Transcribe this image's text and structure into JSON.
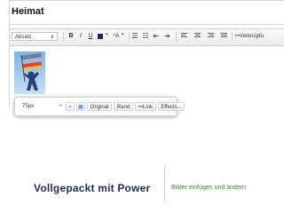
{
  "document": {
    "title": "Heimat"
  },
  "toolbar": {
    "format_select": "Absatz",
    "bold": "B",
    "italic": "I",
    "underline": "U",
    "text_color": "#1a2a55",
    "link_label": "Verknüpfu"
  },
  "image_popup": {
    "size": "75px",
    "original": "Original",
    "border": "Rand",
    "link": "Link",
    "effects": "Effects..."
  },
  "promo": {
    "headline": "Vollgepackt mit Power",
    "feature": "Bilder einfügen und ändern"
  },
  "colors": {
    "headline": "#1f2d4f",
    "feature": "#3a8a1e",
    "photo_sky": "#9ec8ee"
  }
}
